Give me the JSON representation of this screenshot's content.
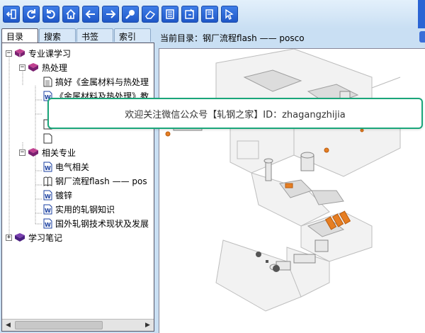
{
  "toolbar": {
    "buttons": [
      {
        "name": "exit-icon"
      },
      {
        "name": "refresh-icon"
      },
      {
        "name": "undo-icon"
      },
      {
        "name": "home-icon"
      },
      {
        "name": "back-arrow-icon"
      },
      {
        "name": "forward-arrow-icon"
      },
      {
        "name": "search-icon"
      },
      {
        "name": "eraser-icon"
      },
      {
        "name": "notes-icon"
      },
      {
        "name": "save-icon"
      },
      {
        "name": "bookmark-icon"
      },
      {
        "name": "pointer-icon"
      }
    ],
    "color": "#2a64d4"
  },
  "tabs": [
    {
      "label": "目录",
      "active": true
    },
    {
      "label": "搜索",
      "active": false
    },
    {
      "label": "书签",
      "active": false
    },
    {
      "label": "索引",
      "active": false
    }
  ],
  "tree": {
    "n1": {
      "label": "专业课学习",
      "expander": "−"
    },
    "n2": {
      "label": "热处理",
      "expander": "−"
    },
    "n3": {
      "label": "搞好《金属材料与热处理"
    },
    "n4": {
      "label": "《金属材料及热处理》教"
    },
    "n5": {
      "label": "相关专业",
      "expander": "−"
    },
    "n6": {
      "label": "电气相关"
    },
    "n7": {
      "label": "钢厂流程flash —— pos"
    },
    "n8": {
      "label": "镀锌"
    },
    "n9": {
      "label": "实用的轧钢知识"
    },
    "n10": {
      "label": "国外轧钢技术现状及发展"
    },
    "n11": {
      "label": "学习笔记",
      "expander": "+"
    }
  },
  "path_bar": {
    "prefix": "当前目录：",
    "path": "钢厂流程flash —— posco"
  },
  "banner": {
    "text": "欢迎关注微信公众号【轧钢之家】ID：zhagangzhijia"
  }
}
